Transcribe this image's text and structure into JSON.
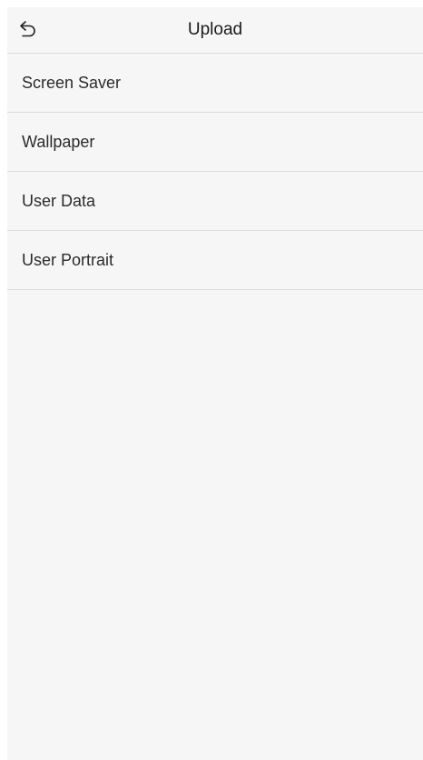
{
  "header": {
    "title": "Upload",
    "back_icon": "back-arrow-icon"
  },
  "menu": {
    "items": [
      {
        "label": "Screen Saver"
      },
      {
        "label": "Wallpaper"
      },
      {
        "label": "User Data"
      },
      {
        "label": "User Portrait"
      }
    ]
  },
  "colors": {
    "background": "#f6f6f6",
    "divider": "#dcdcdc",
    "text": "#2b2b2b"
  }
}
